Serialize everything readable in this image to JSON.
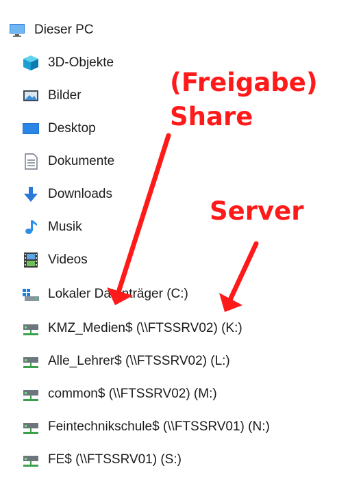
{
  "tree": {
    "root": {
      "label": "Dieser PC",
      "icon": "computer-icon"
    },
    "items": [
      {
        "label": "3D-Objekte",
        "icon": "cube-3d-icon"
      },
      {
        "label": "Bilder",
        "icon": "pictures-icon"
      },
      {
        "label": "Desktop",
        "icon": "desktop-icon"
      },
      {
        "label": "Dokumente",
        "icon": "document-icon"
      },
      {
        "label": "Downloads",
        "icon": "download-arrow-icon"
      },
      {
        "label": "Musik",
        "icon": "music-note-icon"
      },
      {
        "label": "Videos",
        "icon": "video-film-icon"
      },
      {
        "label": "Lokaler Datenträger (C:)",
        "icon": "local-disk-icon"
      },
      {
        "label": "KMZ_Medien$ (\\\\FTSSRV02) (K:)",
        "icon": "network-drive-icon"
      },
      {
        "label": "Alle_Lehrer$ (\\\\FTSSRV02) (L:)",
        "icon": "network-drive-icon"
      },
      {
        "label": "common$ (\\\\FTSSRV02) (M:)",
        "icon": "network-drive-icon"
      },
      {
        "label": "Feintechnikschule$ (\\\\FTSSRV01) (N:)",
        "icon": "network-drive-icon"
      },
      {
        "label": "FE$ (\\\\FTSSRV01) (S:)",
        "icon": "network-drive-icon"
      }
    ]
  },
  "annotations": {
    "freigabe": "(Freigabe)",
    "share": "Share",
    "server": "Server",
    "color": "#ff1a1a"
  }
}
